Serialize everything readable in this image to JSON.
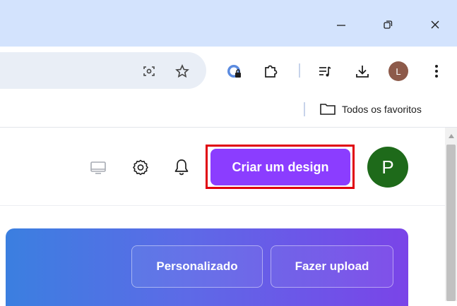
{
  "window_controls": {
    "minimize_glyph": "—",
    "restore_glyph": "⧉",
    "close_glyph": "✕"
  },
  "toolbar": {
    "profile_initial": "L",
    "profile_color": "#8d5a4a"
  },
  "bookmarks": {
    "all_bookmarks_label": "Todos os favoritos"
  },
  "header": {
    "create_design_label": "Criar um design",
    "account_initial": "P",
    "create_color": "#8b3dff",
    "account_color": "#1e6a1a",
    "highlight_color": "#e0000e"
  },
  "banner": {
    "custom_size_label": "Personalizado",
    "upload_label": "Fazer upload"
  }
}
